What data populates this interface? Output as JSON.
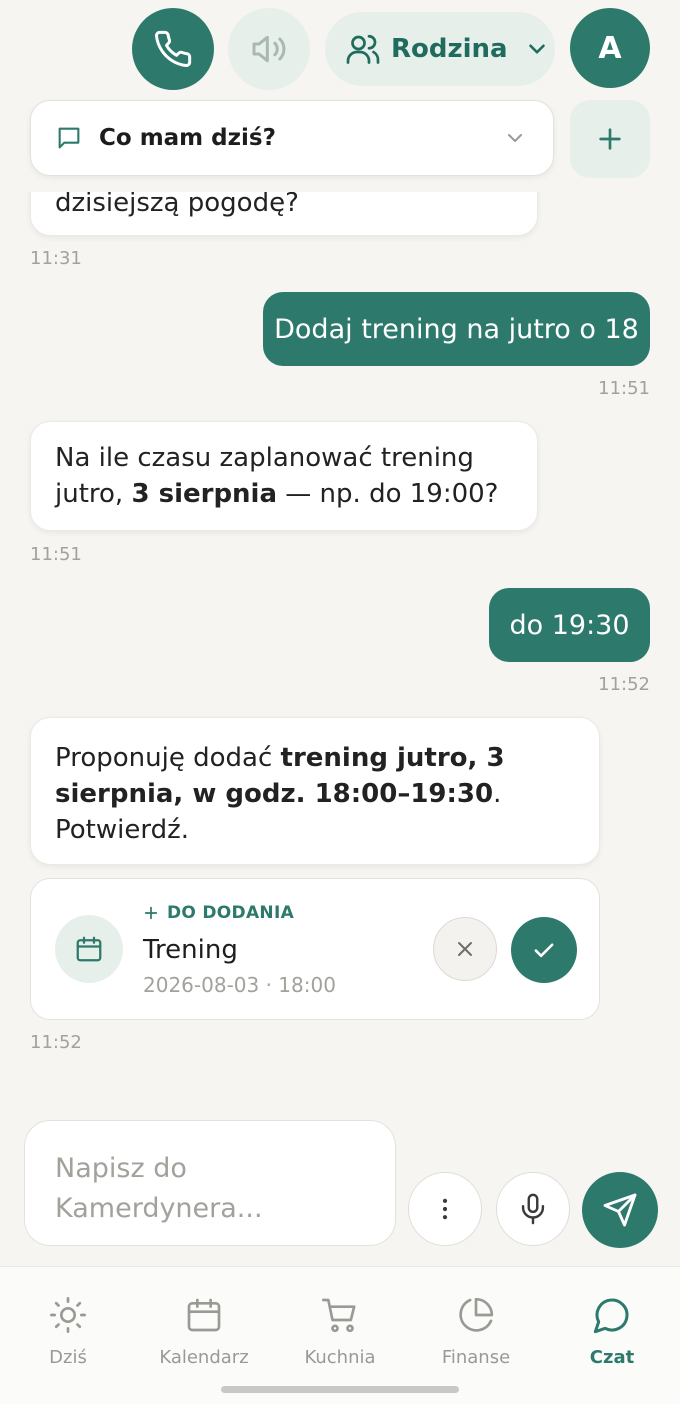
{
  "header": {
    "call_icon": "phone-icon",
    "speaker_icon": "speaker-icon",
    "family_label": "Rodzina",
    "avatar_letter": "A"
  },
  "topic": {
    "label": "Co mam dziś?",
    "add_icon": "plus-icon"
  },
  "messages": [
    {
      "from": "assistant",
      "text": "dzisiejszą pogodę?",
      "time": "11:31"
    },
    {
      "from": "user",
      "text": "Dodaj trening na jutro o 18",
      "time": "11:51"
    },
    {
      "from": "assistant",
      "text_before": "Na ile czasu zaplanować trening jutro, ",
      "bold": "3 sierpnia",
      "text_after": " — np. do 19:00?",
      "time": "11:51"
    },
    {
      "from": "user",
      "text": "do 19:30",
      "time": "11:52"
    },
    {
      "from": "assistant",
      "text_before": "Proponuję dodać ",
      "bold": "trening jutro, 3 sierpnia, w godz. 18:00–19:30",
      "text_after": ". Potwierdź.",
      "time": ""
    }
  ],
  "action_card": {
    "tag": "DO DODANIA",
    "title": "Trening",
    "datetime": "2026-08-03 · 18:00",
    "time": "11:52"
  },
  "composer": {
    "placeholder": "Napisz do Kamerdynera..."
  },
  "nav": [
    {
      "label": "Dziś",
      "icon": "sun-icon",
      "active": false
    },
    {
      "label": "Kalendarz",
      "icon": "calendar-icon",
      "active": false
    },
    {
      "label": "Kuchnia",
      "icon": "cart-icon",
      "active": false
    },
    {
      "label": "Finanse",
      "icon": "pie-chart-icon",
      "active": false
    },
    {
      "label": "Czat",
      "icon": "chat-icon",
      "active": true
    }
  ],
  "colors": {
    "accent": "#2d7a6c",
    "accent_light": "#e7efeb",
    "background": "#f6f5f1"
  }
}
